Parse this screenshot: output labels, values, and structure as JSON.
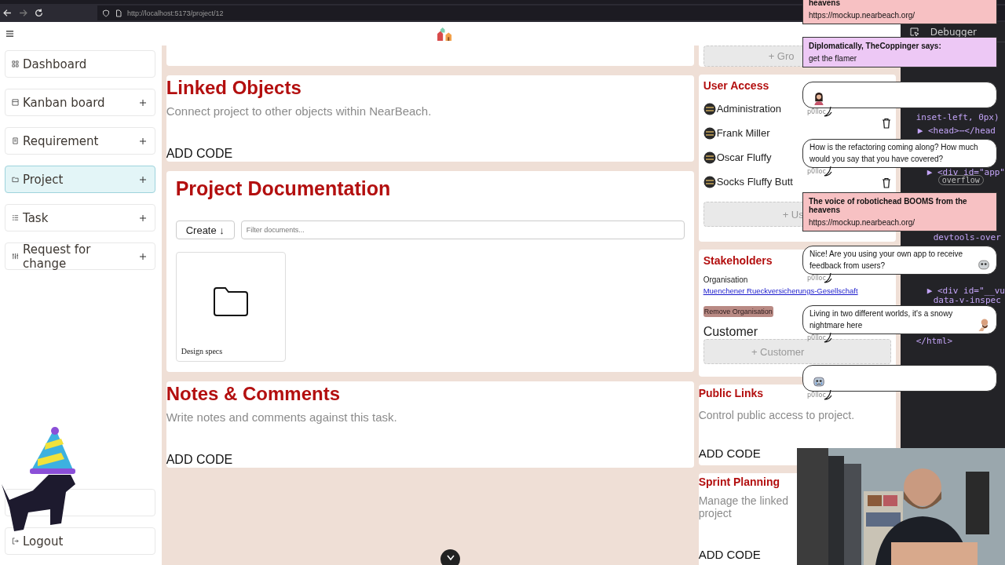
{
  "browser": {
    "url": "http://localhost:5173/project/12"
  },
  "sidebar": {
    "items": [
      {
        "label": "Dashboard",
        "can_add": false,
        "selected": false
      },
      {
        "label": "Kanban board",
        "can_add": true,
        "selected": false
      },
      {
        "label": "Requirement",
        "can_add": true,
        "selected": false
      },
      {
        "label": "Project",
        "can_add": true,
        "selected": true
      },
      {
        "label": "Task",
        "can_add": true,
        "selected": false
      },
      {
        "label": "Request for change",
        "can_add": true,
        "selected": false
      }
    ],
    "logout": "Logout"
  },
  "linked_objects": {
    "title": "Linked Objects",
    "description": "Connect project to other objects within NearBeach.",
    "action": "ADD CODE"
  },
  "documentation": {
    "title": "Project Documentation",
    "create_button": "Create ↓",
    "filter_placeholder": "Filter documents...",
    "documents": [
      {
        "name": "Design specs"
      }
    ]
  },
  "notes": {
    "title": "Notes & Comments",
    "description": "Write notes and comments against this task.",
    "action": "ADD CODE"
  },
  "right": {
    "group_button": "+ Gro",
    "user_access": {
      "title": "User Access",
      "users": [
        {
          "name": "Administration"
        },
        {
          "name": "Frank Miller"
        },
        {
          "name": "Oscar Fluffy"
        },
        {
          "name": "Socks Fluffy Butt"
        }
      ],
      "add_button": "+ Us"
    },
    "stakeholders": {
      "title": "Stakeholders",
      "organisation_label": "Organisation",
      "organisation": "Muenchener Rueckversicherungs-Gesellschaft",
      "remove_button": "Remove Organisation",
      "customer_title": "Customer",
      "add_customer": "+ Customer"
    },
    "public_links": {
      "title": "Public Links",
      "description": "Control public access to project.",
      "action": "ADD CODE"
    },
    "sprint_planning": {
      "title": "Sprint Planning",
      "description": "Manage the linked project",
      "action": "ADD CODE"
    }
  },
  "devtools": {
    "tab": "Debugger",
    "lines": [
      "inset-left, 0px)",
      "▶ <head>⋯</head",
      "▶ <div id=\"app\"",
      "overflow",
      "devtools-over",
      "▶ <div id=\"__vu",
      "data-v-inspec",
      "</html>"
    ]
  },
  "chat": [
    {
      "kind": "notice",
      "color": "#f7c1c3",
      "title": "heavens",
      "text": "https://mockup.nearbeach.org/"
    },
    {
      "kind": "notice",
      "color": "#edc8f5",
      "title": "Diplomatically, TheCoppinger says:",
      "text": "get the flamer"
    },
    {
      "kind": "bubble",
      "user": "p0lloc",
      "deletable": true
    },
    {
      "kind": "bubble",
      "text": "How is the refactoring coming along? How much would you say that you have covered?",
      "user": "p0lloc",
      "deletable": true
    },
    {
      "kind": "notice",
      "color": "#f7c1c3",
      "title": "The voice of robotichead BOOMS from the heavens",
      "text": "https://mockup.nearbeach.org/"
    },
    {
      "kind": "bubble",
      "text": "Nice! Are you using your own app to receive feedback from users?",
      "user": "p0lloc",
      "deletable": false
    },
    {
      "kind": "bubble",
      "text": "Living in two different worlds, it's a snowy nightmare here",
      "user": "p0lloc",
      "deletable": false
    },
    {
      "kind": "bubble",
      "user": "p0lloc",
      "deletable": false
    }
  ]
}
